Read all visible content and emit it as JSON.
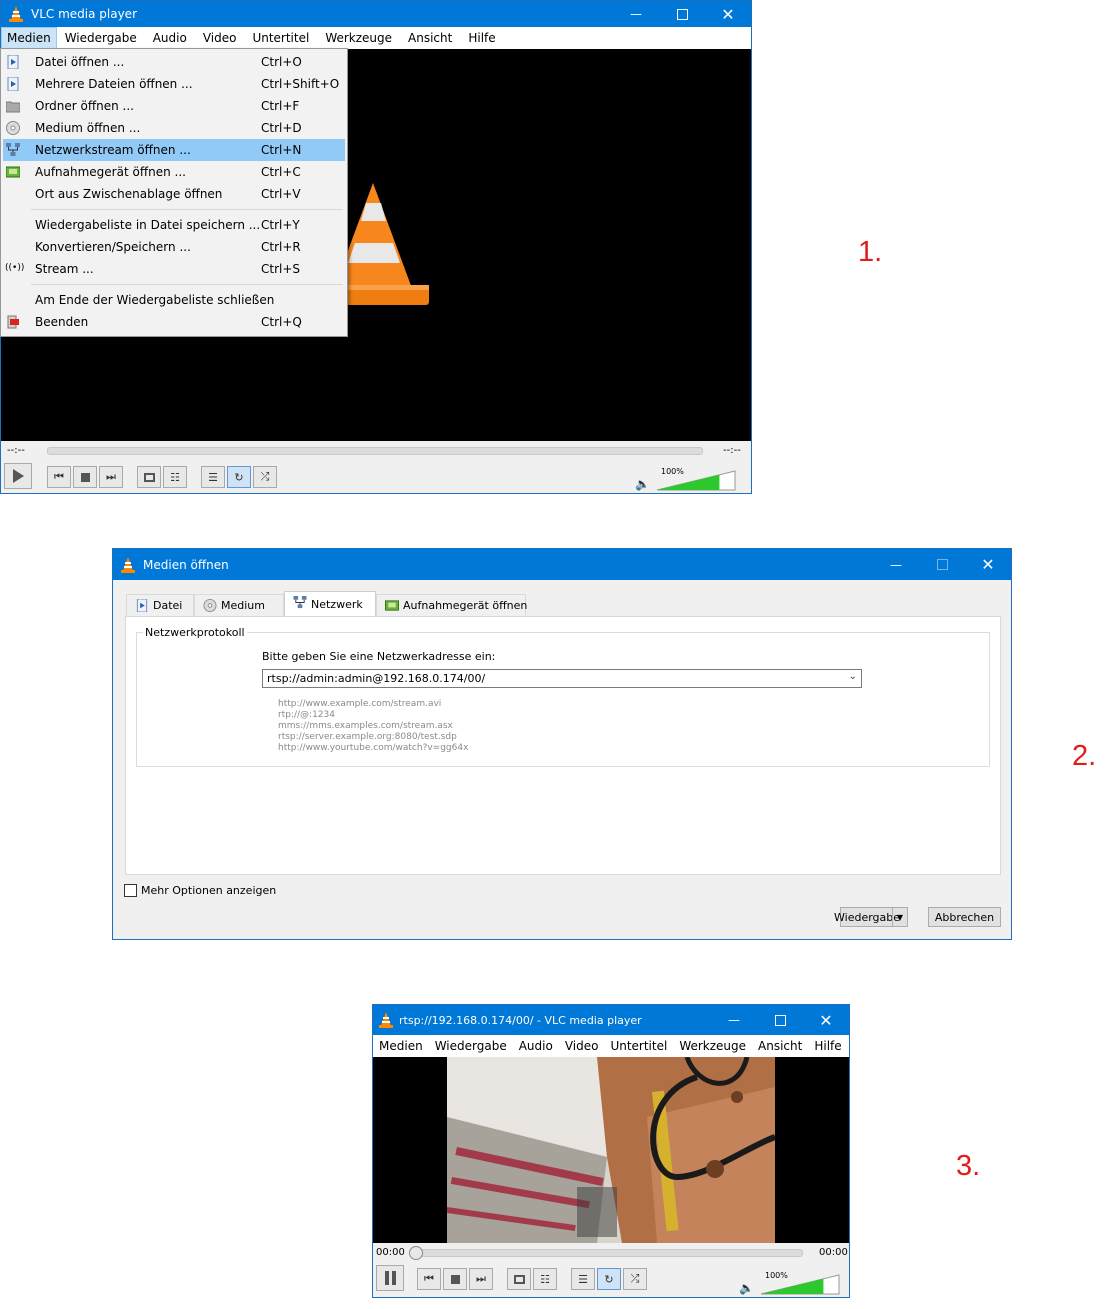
{
  "step_labels": [
    "1.",
    "2.",
    "3."
  ],
  "window1": {
    "title": "VLC media player",
    "menu": [
      "Medien",
      "Wiedergabe",
      "Audio",
      "Video",
      "Untertitel",
      "Werkzeuge",
      "Ansicht",
      "Hilfe"
    ],
    "time_left": "--:--",
    "time_right": "--:--",
    "volume": "100%",
    "volume_level": 1.0
  },
  "media_menu": {
    "items": [
      {
        "label": "Datei öffnen ...",
        "shortcut": "Ctrl+O",
        "icon": "file-play-icon"
      },
      {
        "label": "Mehrere Dateien öffnen ...",
        "shortcut": "Ctrl+Shift+O",
        "icon": "files-play-icon"
      },
      {
        "label": "Ordner öffnen ...",
        "shortcut": "Ctrl+F",
        "icon": "folder-icon"
      },
      {
        "label": "Medium öffnen ...",
        "shortcut": "Ctrl+D",
        "icon": "disc-icon"
      },
      {
        "label": "Netzwerkstream öffnen ...",
        "shortcut": "Ctrl+N",
        "icon": "network-icon",
        "highlighted": true
      },
      {
        "label": "Aufnahmegerät öffnen ...",
        "shortcut": "Ctrl+C",
        "icon": "capture-card-icon"
      },
      {
        "label": "Ort aus Zwischenablage öffnen",
        "shortcut": "Ctrl+V",
        "icon": ""
      },
      {
        "label": "Wiedergabeliste in Datei speichern ...",
        "shortcut": "Ctrl+Y",
        "icon": ""
      },
      {
        "label": "Konvertieren/Speichern ...",
        "shortcut": "Ctrl+R",
        "icon": ""
      },
      {
        "label": "Stream ...",
        "shortcut": "Ctrl+S",
        "icon": "broadcast-icon"
      },
      {
        "label": "Am Ende der Wiedergabeliste schließen",
        "shortcut": "",
        "icon": ""
      },
      {
        "label": "Beenden",
        "shortcut": "Ctrl+Q",
        "icon": "exit-icon"
      }
    ]
  },
  "dialog": {
    "title": "Medien öffnen",
    "tabs": [
      "Datei",
      "Medium",
      "Netzwerk",
      "Aufnahmegerät öffnen"
    ],
    "active_tab": "Netzwerk",
    "group_label": "Netzwerkprotokoll",
    "prompt": "Bitte geben Sie eine Netzwerkadresse ein:",
    "url_value": "rtsp://admin:admin@192.168.0.174/00/",
    "examples": [
      "http://www.example.com/stream.avi",
      "rtp://@:1234",
      "mms://mms.examples.com/stream.asx",
      "rtsp://server.example.org:8080/test.sdp",
      "http://www.yourtube.com/watch?v=gg64x"
    ],
    "more_options": "Mehr Optionen anzeigen",
    "play_button": "Wiedergabe",
    "cancel_button": "Abbrechen"
  },
  "window3": {
    "title": "rtsp://192.168.0.174/00/ - VLC media player",
    "menu": [
      "Medien",
      "Wiedergabe",
      "Audio",
      "Video",
      "Untertitel",
      "Werkzeuge",
      "Ansicht",
      "Hilfe"
    ],
    "time_left": "00:00",
    "time_right": "00:00",
    "volume": "100%",
    "volume_level": 1.0
  }
}
